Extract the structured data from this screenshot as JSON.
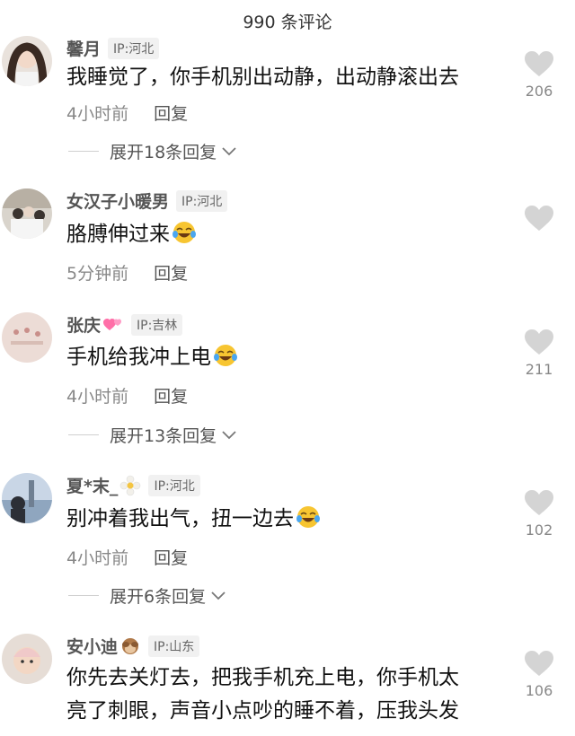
{
  "header": {
    "title": "990 条评论"
  },
  "comments": [
    {
      "username": "馨月",
      "ip": "IP:河北",
      "lines": [
        "我睡觉了，你手机别出动静，出动静滚出去"
      ],
      "time": "4小时前",
      "reply": "回复",
      "expand": "展开18条回复",
      "likes": "206"
    },
    {
      "username": "女汉子小暖男",
      "ip": "IP:河北",
      "lines": [
        "胳膊伸过来"
      ],
      "time": "5分钟前",
      "reply": "回复",
      "likes": ""
    },
    {
      "username": "张庆",
      "ip": "IP:吉林",
      "lines": [
        "手机给我冲上电"
      ],
      "time": "4小时前",
      "reply": "回复",
      "expand": "展开13条回复",
      "likes": "211"
    },
    {
      "username": "夏*末_",
      "ip": "IP:河北",
      "lines": [
        "别冲着我出气，扭一边去"
      ],
      "time": "4小时前",
      "reply": "回复",
      "expand": "展开6条回复",
      "likes": "102"
    },
    {
      "username": "安小迪",
      "ip": "IP:山东",
      "lines": [
        "你先去关灯去，把我手机充上电，你手机太",
        "亮了刺眼，声音小点吵的睡不着，压我头发"
      ],
      "likes": "106"
    }
  ],
  "icons": {
    "like": "heart-icon",
    "laugh": "tears-of-joy-emoji",
    "chevron": "chevron-down-icon"
  },
  "colors": {
    "heart": "#d4d4d4",
    "badge_bg": "#f1f1f1",
    "text": "#111111",
    "meta": "#888888"
  }
}
